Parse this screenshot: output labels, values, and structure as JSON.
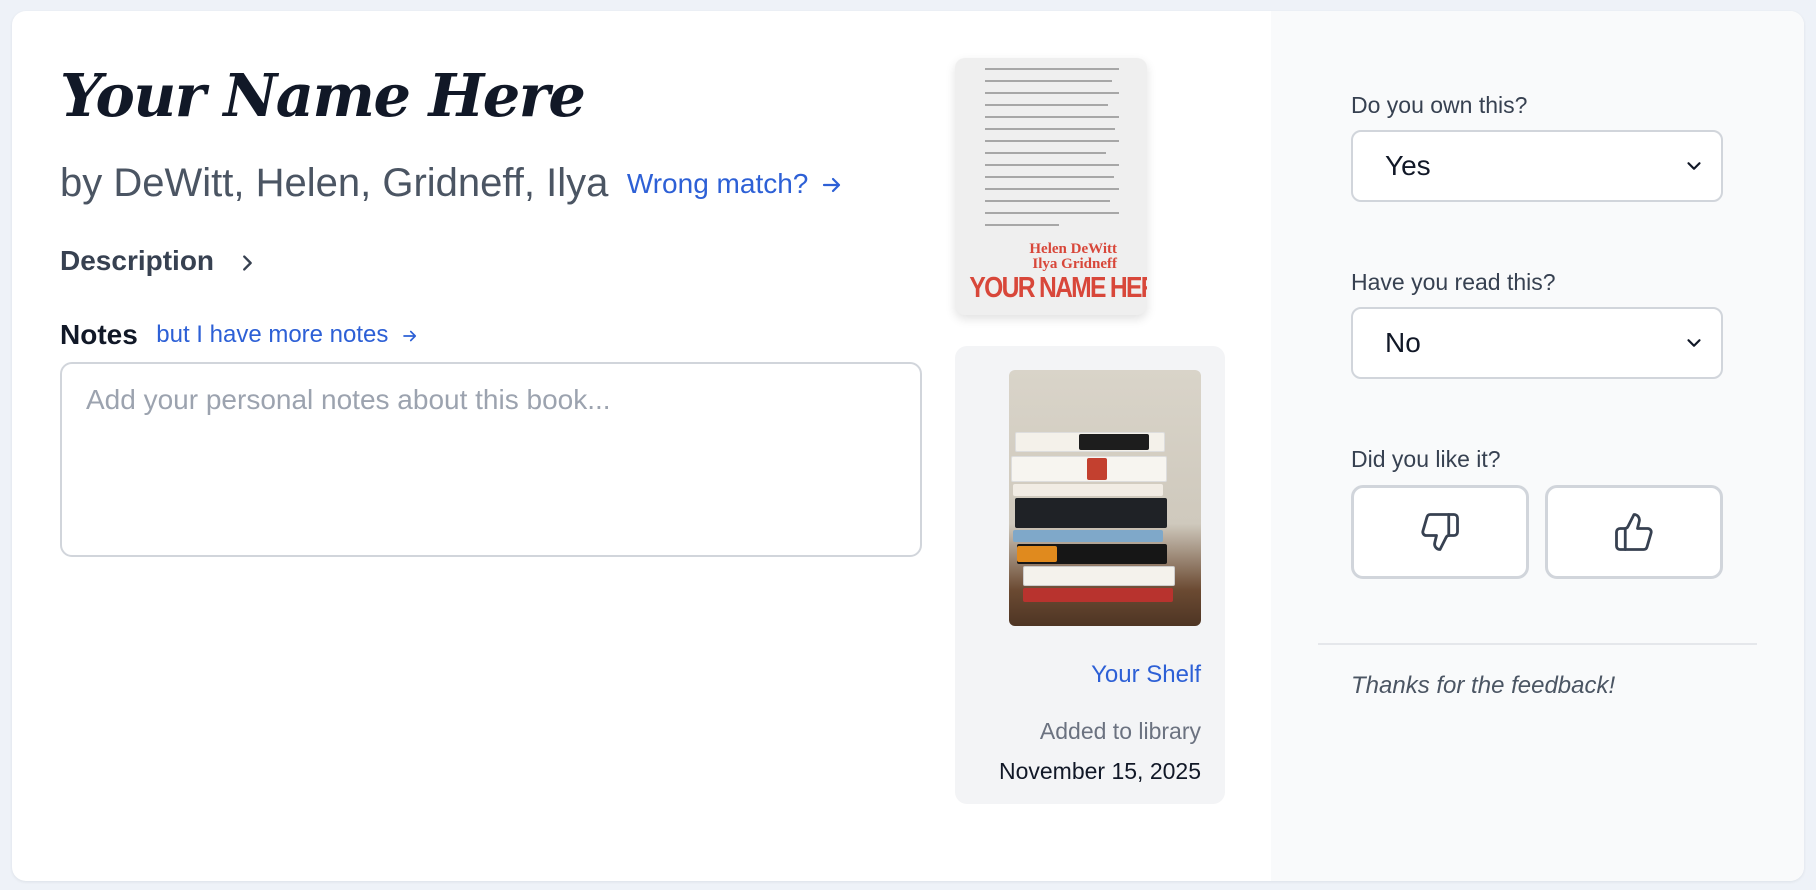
{
  "book": {
    "title": "Your Name Here",
    "authors": "by DeWitt, Helen, Gridneff, Ilya",
    "wrong_match_label": "Wrong match?"
  },
  "description": {
    "label": "Description"
  },
  "notes": {
    "label": "Notes",
    "more_link": "but I have more notes",
    "placeholder": "Add your personal notes about this book..."
  },
  "cover": {
    "author_line_1": "Helen DeWitt",
    "author_line_2": "Ilya Gridneff",
    "title_text": "YOUR NAME HERE"
  },
  "shelf": {
    "link_label": "Your Shelf",
    "added_label": "Added to library",
    "added_date": "November 15, 2025"
  },
  "questions": {
    "own": {
      "label": "Do you own this?",
      "value": "Yes"
    },
    "read": {
      "label": "Have you read this?",
      "value": "No"
    },
    "liked": {
      "label": "Did you like it?"
    }
  },
  "feedback": {
    "thanks": "Thanks for the feedback!"
  },
  "colors": {
    "accent": "#2d60d6",
    "cover_red": "#d8473a",
    "panel_bg": "#f9fafb"
  },
  "icons": {
    "wrong_match": "arrow-right-icon",
    "description": "chevron-right-icon",
    "notes_more": "arrow-right-icon",
    "select": "chevron-down-icon",
    "dislike": "thumbs-down-icon",
    "like": "thumbs-up-icon"
  }
}
